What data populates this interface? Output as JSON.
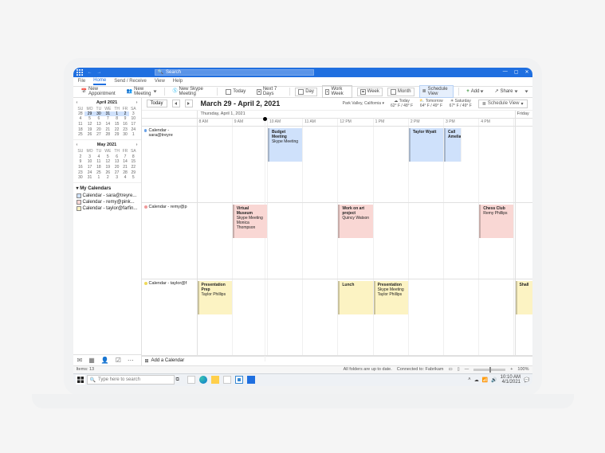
{
  "titlebar": {
    "search_placeholder": "Search"
  },
  "tabs": [
    "File",
    "Home",
    "Send / Receive",
    "View",
    "Help"
  ],
  "ribbon": {
    "new_appointment": "New Appointment",
    "new_meeting": "New Meeting",
    "new_skype": "New Skype Meeting",
    "today": "Today",
    "next7": "Next 7 Days",
    "day": "Day",
    "work_week": "Work Week",
    "week": "Week",
    "month": "Month",
    "schedule_view": "Schedule View",
    "add": "Add",
    "share": "Share"
  },
  "minicals": [
    {
      "title": "April 2021",
      "dow": [
        "SU",
        "MO",
        "TU",
        "WE",
        "TH",
        "FR",
        "SA"
      ],
      "rows": [
        [
          "28",
          "29",
          "30",
          "31",
          "1",
          "2",
          "3"
        ],
        [
          "4",
          "5",
          "6",
          "7",
          "8",
          "9",
          "10"
        ],
        [
          "11",
          "12",
          "13",
          "14",
          "15",
          "16",
          "17"
        ],
        [
          "18",
          "19",
          "20",
          "21",
          "22",
          "23",
          "24"
        ],
        [
          "25",
          "26",
          "27",
          "28",
          "29",
          "30",
          "1"
        ]
      ],
      "highlight_row": 0,
      "highlight_cells": [
        1,
        2,
        3,
        4,
        5
      ]
    },
    {
      "title": "May 2021",
      "dow": [
        "SU",
        "MO",
        "TU",
        "WE",
        "TH",
        "FR",
        "SA"
      ],
      "rows": [
        [
          "2",
          "3",
          "4",
          "5",
          "6",
          "7",
          "8"
        ],
        [
          "9",
          "10",
          "11",
          "12",
          "13",
          "14",
          "15"
        ],
        [
          "16",
          "17",
          "18",
          "19",
          "20",
          "21",
          "22"
        ],
        [
          "23",
          "24",
          "25",
          "26",
          "27",
          "28",
          "29"
        ],
        [
          "30",
          "31",
          "1",
          "2",
          "3",
          "4",
          "5"
        ]
      ],
      "highlight_row": -1
    }
  ],
  "mycalendars": {
    "heading": "My Calendars",
    "items": [
      {
        "color": "#cfe1fb",
        "label": "Calendar - sara@treyre..."
      },
      {
        "color": "#f9d7d4",
        "label": "Calendar - remy@pink..."
      },
      {
        "color": "#fcf3c3",
        "label": "Calendar - taylor@farfin..."
      }
    ]
  },
  "header": {
    "today_btn": "Today",
    "date_range": "March 29 - April 2, 2021",
    "location": "Park Valley, California",
    "forecast": [
      {
        "day": "Today",
        "temp": "62° F / 48° F",
        "icon": "cloud"
      },
      {
        "day": "Tomorrow",
        "temp": "64° F / 49° F",
        "icon": "partly"
      },
      {
        "day": "Saturday",
        "temp": "67° F / 49° F",
        "icon": "sun"
      }
    ],
    "schedule_view_btn": "Schedule View"
  },
  "columns": {
    "day_label": "Thursday, April 1, 2021",
    "hours": [
      "8 AM",
      "9 AM",
      "10 AM",
      "11 AM",
      "12 PM",
      "1 PM",
      "2 PM",
      "3 PM",
      "4 PM"
    ],
    "friday": "Friday"
  },
  "calendars": [
    {
      "label": "Calendar - sara@treyre",
      "dot": "blue",
      "events": [
        {
          "title": "Budget Meeting",
          "sub": "Skype Meeting",
          "start": 2,
          "span": 1,
          "color": "blue"
        },
        {
          "title": "Taylor Wyatt",
          "sub": "",
          "start": 6,
          "span": 1,
          "color": "blue"
        },
        {
          "title": "Call Amelia",
          "sub": "",
          "start": 7,
          "span": 0.5,
          "color": "blue"
        }
      ],
      "friday": null
    },
    {
      "label": "Calendar - remy@p",
      "dot": "pink",
      "events": [
        {
          "title": "Virtual Museum",
          "sub": "Skype Meeting\nMonica Thompson",
          "start": 1,
          "span": 1,
          "color": "pink"
        },
        {
          "title": "Work on art project",
          "sub": "Quincy Watson",
          "start": 4,
          "span": 1,
          "color": "pink"
        },
        {
          "title": "Chess Club",
          "sub": "Remy Phillips",
          "start": 8,
          "span": 1,
          "color": "pink"
        }
      ],
      "friday": null
    },
    {
      "label": "Calendar - taylor@f",
      "dot": "yellow",
      "events": [
        {
          "title": "Presentation Prep",
          "sub": "Taylor Phillips",
          "start": 0,
          "span": 1,
          "color": "yellow"
        },
        {
          "title": "Lunch",
          "sub": "",
          "start": 4,
          "span": 1,
          "color": "yellow"
        },
        {
          "title": "Presentation",
          "sub": "Skype Meeting\nTaylor Phillips",
          "start": 5,
          "span": 1,
          "color": "yellow"
        }
      ],
      "friday": {
        "title": "Shall",
        "color": "yellow"
      }
    }
  ],
  "now_hour_fraction": 1.9,
  "add_calendar": "Add a Calendar",
  "status": {
    "items": "Items: 13",
    "folders": "All folders are up to date.",
    "connected": "Connected to: Fabrikam",
    "zoom": "100%"
  },
  "taskbar": {
    "search": "Type here to search",
    "time": "10:10 AM",
    "date": "4/1/2021"
  }
}
